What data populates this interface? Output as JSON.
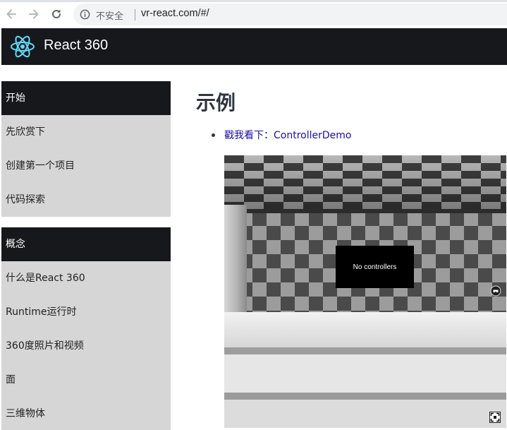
{
  "browser": {
    "insecure_label": "不安全",
    "url": "vr-react.com/#/",
    "icons": {
      "back": "arrow-left-icon",
      "forward": "arrow-right-icon",
      "reload": "reload-icon",
      "info": "info-icon"
    }
  },
  "header": {
    "brand": "React 360",
    "logo_icon": "react-atom-logo",
    "colors": {
      "background": "#17181c",
      "logo": "#61dafb"
    }
  },
  "sidebar": {
    "sections": [
      {
        "title": "开始",
        "items": [
          "先欣赏下",
          "创建第一个项目",
          "代码探索"
        ]
      },
      {
        "title": "概念",
        "items": [
          "什么是React 360",
          "Runtime运行时",
          "360度照片和视频",
          "面",
          "三维物体"
        ]
      }
    ],
    "colors": {
      "section_head": "#17181c",
      "item_bg": "#d6d6d6"
    }
  },
  "main": {
    "title": "示例",
    "examples": [
      {
        "label": "戳我看下：ControllerDemo"
      }
    ],
    "demo": {
      "panel_text": "No controllers",
      "icons": {
        "vr": "vr-headset-icon",
        "fullscreen": "fullscreen-icon"
      }
    },
    "colors": {
      "link": "#1a0dab",
      "title": "#2f3640"
    }
  }
}
